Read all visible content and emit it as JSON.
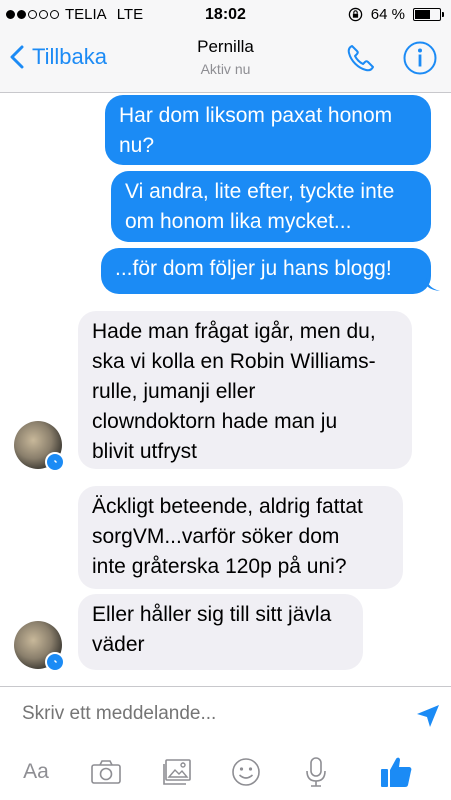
{
  "status_bar": {
    "carrier": "TELIA",
    "network": "LTE",
    "time": "18:02",
    "battery": "64 %",
    "battery_level": 0.64,
    "signal_bars_filled": 2,
    "signal_bars_total": 5
  },
  "nav": {
    "back_label": "Tillbaka",
    "contact_name": "Pernilla",
    "contact_status": "Aktiv nu",
    "call_icon": "phone-icon",
    "info_icon": "info-icon"
  },
  "colors": {
    "accent": "#1b8bf5",
    "incoming_bubble": "#f0eff4",
    "placeholder": "#a9a9ae",
    "toolbar_icon": "#8e8e93"
  },
  "messages": [
    {
      "direction": "outgoing",
      "text": "Har dom liksom paxat honom nu?"
    },
    {
      "direction": "outgoing",
      "text": "Vi andra, lite efter, tyckte inte om honom lika mycket..."
    },
    {
      "direction": "outgoing",
      "text": "...för dom följer ju hans blogg!"
    },
    {
      "direction": "incoming",
      "text": "Hade man frågat igår, men du, ska vi kolla en Robin Williams-rulle, jumanji eller clowndoktorn hade man ju blivit utfryst"
    },
    {
      "direction": "incoming",
      "text": "Äckligt beteende, aldrig fattat sorgVM...varför söker dom inte gråterska 120p på uni?"
    },
    {
      "direction": "incoming",
      "text": "Eller håller sig till sitt jävla väder"
    }
  ],
  "message_lines": {
    "m0": [
      "Har dom liksom paxat honom",
      "nu?"
    ],
    "m1": [
      "Vi andra, lite efter, tyckte inte",
      "om honom lika mycket..."
    ],
    "m2": [
      "...för dom följer ju hans blogg!"
    ],
    "m3": [
      "Hade man frågat igår, men du,",
      "ska vi kolla en Robin Williams-",
      "rulle, jumanji eller",
      "clowndoktorn hade man ju",
      "blivit utfryst"
    ],
    "m4": [
      "Äckligt beteende, aldrig fattat",
      "sorgVM...varför söker dom",
      "inte gråterska 120p på uni?"
    ],
    "m5": [
      "Eller håller sig till sitt jävla",
      "väder"
    ]
  },
  "input": {
    "placeholder": "Skriv ett meddelande...",
    "value": ""
  },
  "toolbar": {
    "text_label": "Aa",
    "icons": [
      "camera-icon",
      "gallery-icon",
      "emoji-icon",
      "microphone-icon",
      "thumbs-up-icon"
    ]
  }
}
